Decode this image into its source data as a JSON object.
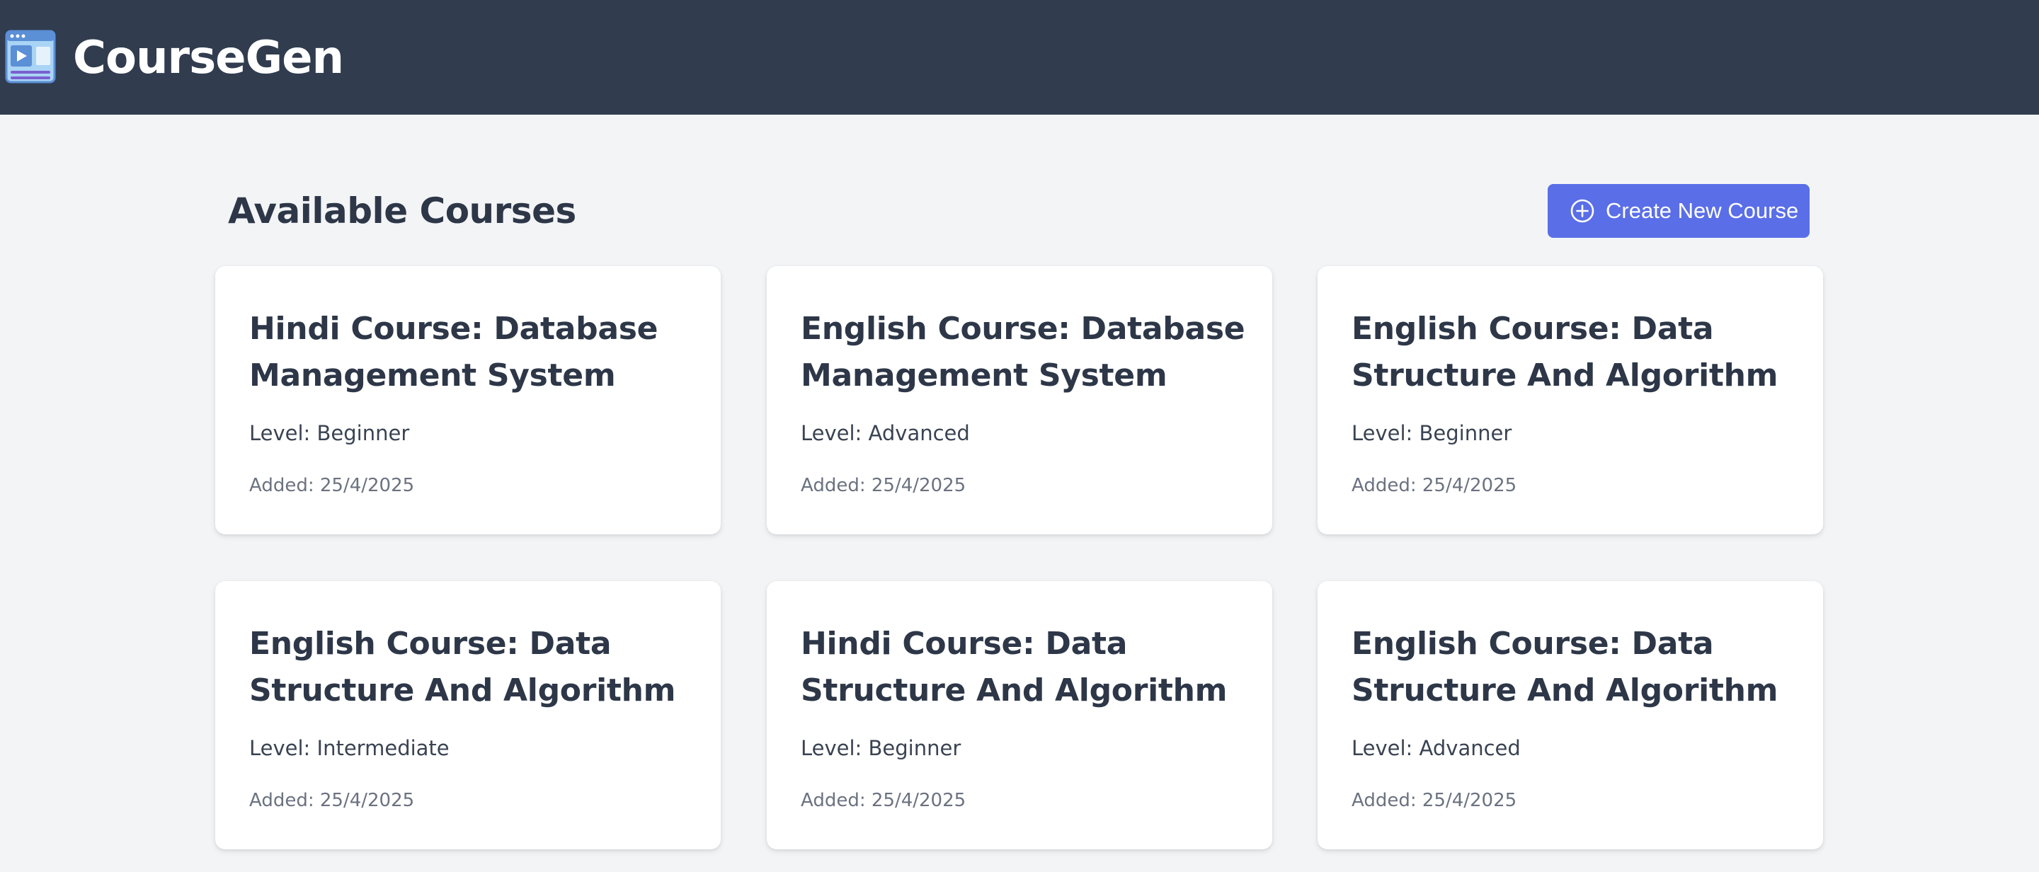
{
  "app": {
    "title": "CourseGen",
    "logo_icon": "video-course-icon"
  },
  "main": {
    "heading": "Available Courses",
    "create_button": {
      "label": "Create New Course",
      "icon": "plus-circle-icon"
    }
  },
  "courses": [
    {
      "title": "Hindi Course: Database Management System",
      "level": "Level: Beginner",
      "added": "Added: 25/4/2025"
    },
    {
      "title": "English Course: Database Management System",
      "level": "Level: Advanced",
      "added": "Added: 25/4/2025"
    },
    {
      "title": "English Course: Data Structure And Algorithm",
      "level": "Level: Beginner",
      "added": "Added: 25/4/2025"
    },
    {
      "title": "English Course: Data Structure And Algorithm",
      "level": "Level: Intermediate",
      "added": "Added: 25/4/2025"
    },
    {
      "title": "Hindi Course: Data Structure And Algorithm",
      "level": "Level: Beginner",
      "added": "Added: 25/4/2025"
    },
    {
      "title": "English Course: Data Structure And Algorithm",
      "level": "Level: Advanced",
      "added": "Added: 25/4/2025"
    }
  ],
  "colors": {
    "header_bg": "#313c4f",
    "page_bg": "#f3f4f6",
    "accent": "#5a6ee8",
    "title_text": "#2d3748",
    "muted_text": "#6b7280"
  }
}
